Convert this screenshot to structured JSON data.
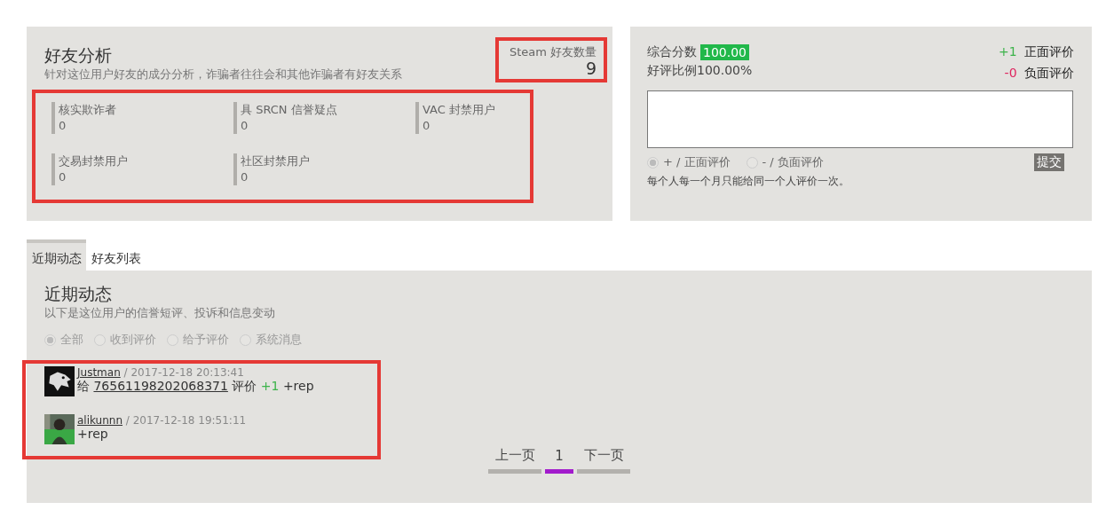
{
  "friends": {
    "title": "好友分析",
    "subtitle": "针对这位用户好友的成分分析，诈骗者往往会和其他诈骗者有好友关系",
    "count_label": "Steam 好友数量",
    "count": "9",
    "stats": [
      {
        "label": "核实欺诈者",
        "value": "0"
      },
      {
        "label": "具 SRCN 信誉疑点",
        "value": "0"
      },
      {
        "label": "VAC 封禁用户",
        "value": "0"
      },
      {
        "label": "交易封禁用户",
        "value": "0"
      },
      {
        "label": "社区封禁用户",
        "value": "0"
      }
    ]
  },
  "rating": {
    "score_label": "综合分数",
    "score": "100.00",
    "ratio": "好评比例100.00%",
    "counts": [
      {
        "kind": "positive",
        "count": "+1",
        "caption": "正面评价"
      },
      {
        "kind": "negative",
        "count": "-0",
        "caption": "负面评价"
      }
    ],
    "options": [
      {
        "label": "+ / 正面评价",
        "selected": true
      },
      {
        "label": "- / 负面评价",
        "selected": false
      }
    ],
    "submit": "提交",
    "note": "每个人每一个月只能给同一个人评价一次。"
  },
  "tabs": [
    {
      "label": "近期动态",
      "selected": true
    },
    {
      "label": "好友列表",
      "selected": false
    }
  ],
  "activity": {
    "title": "近期动态",
    "subtitle": "以下是这位用户的信誉短评、投诉和信息变动",
    "filters": [
      {
        "label": "全部",
        "selected": true
      },
      {
        "label": "收到评价",
        "selected": false
      },
      {
        "label": "给予评价",
        "selected": false
      },
      {
        "label": "系统消息",
        "selected": false
      }
    ],
    "entries": [
      {
        "user": "Justman",
        "time": " / 2017-12-18 20:13:41",
        "kind": "given",
        "prefix": "给",
        "target": "76561198202068371",
        "middle": "评价",
        "delta": "+1",
        "suffix": "+rep"
      },
      {
        "user": "alikunnn",
        "time": " / 2017-12-18 19:51:11",
        "kind": "plain",
        "suffix": "+rep"
      }
    ],
    "pager": {
      "prev": "上一页",
      "pages": [
        {
          "label": "1",
          "selected": true
        }
      ],
      "next": "下一页"
    }
  }
}
